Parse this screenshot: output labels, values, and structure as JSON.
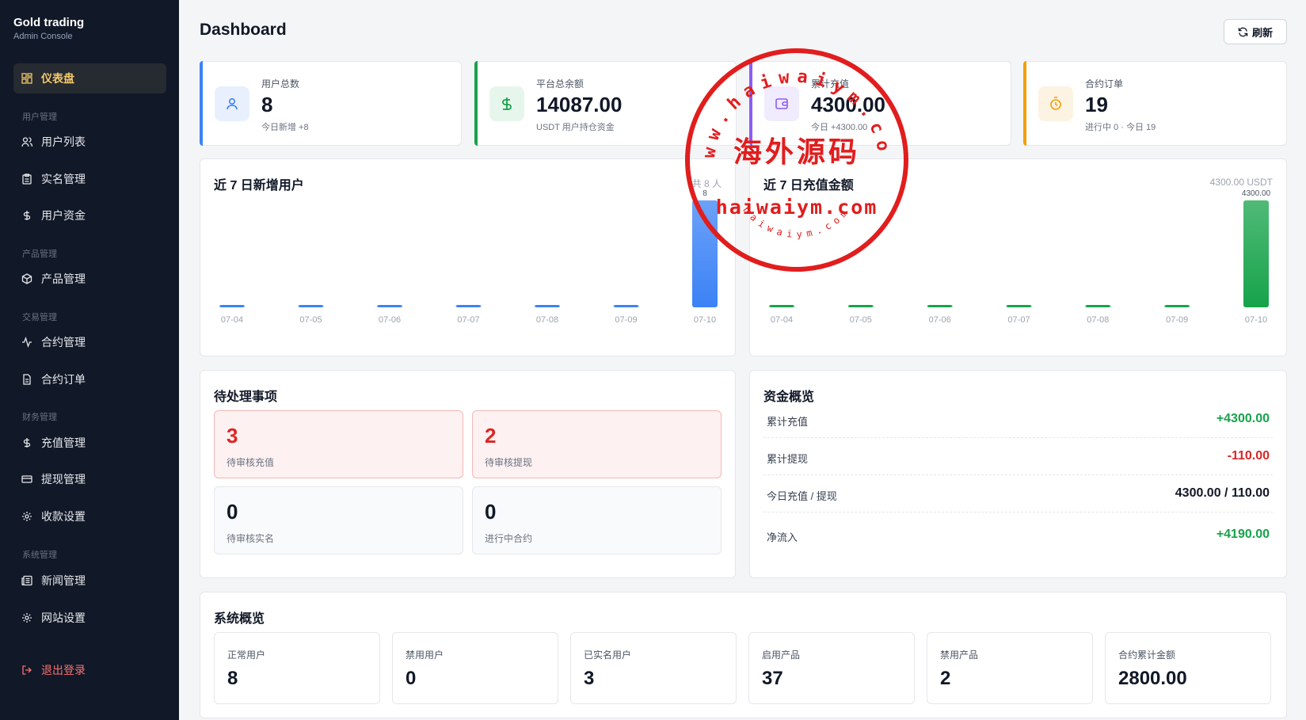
{
  "brand": {
    "title": "Gold trading",
    "subtitle": "Admin Console"
  },
  "nav": {
    "dashboard": "仪表盘",
    "group_users": "用户管理",
    "user_list": "用户列表",
    "kyc": "实名管理",
    "user_funds": "用户资金",
    "group_products": "产品管理",
    "products": "产品管理",
    "group_trading": "交易管理",
    "contracts": "合约管理",
    "contract_orders": "合约订单",
    "group_finance": "财务管理",
    "recharge": "充值管理",
    "withdraw": "提现管理",
    "payment_settings": "收款设置",
    "group_system": "系统管理",
    "news": "新闻管理",
    "site_settings": "网站设置",
    "logout": "退出登录"
  },
  "header": {
    "title": "Dashboard",
    "refresh_label": "刷新"
  },
  "stats": [
    {
      "label": "用户总数",
      "value": "8",
      "sub": "今日新增 +8",
      "accent": "#3b82f6"
    },
    {
      "label": "平台总余额",
      "value": "14087.00",
      "sub": "USDT 用户持仓资金",
      "accent": "#16a34a"
    },
    {
      "label": "累计充值",
      "value": "4300.00",
      "sub": "今日 +4300.00",
      "accent": "#8b5cf6"
    },
    {
      "label": "合约订单",
      "value": "19",
      "sub": "进行中 0 · 今日 19",
      "accent": "#f59e0b"
    }
  ],
  "chart_data": [
    {
      "type": "bar",
      "title": "近 7 日新增用户",
      "meta": "共 8 人",
      "categories": [
        "07-04",
        "07-05",
        "07-06",
        "07-07",
        "07-08",
        "07-09",
        "07-10"
      ],
      "values": [
        0,
        0,
        0,
        0,
        0,
        0,
        8
      ],
      "value_labels": [
        "",
        "",
        "",
        "",
        "",
        "",
        "8"
      ],
      "color": "#3b82f6"
    },
    {
      "type": "bar",
      "title": "近 7 日充值金额",
      "meta": "4300.00 USDT",
      "categories": [
        "07-04",
        "07-05",
        "07-06",
        "07-07",
        "07-08",
        "07-09",
        "07-10"
      ],
      "values": [
        0,
        0,
        0,
        0,
        0,
        0,
        4300
      ],
      "value_labels": [
        "",
        "",
        "",
        "",
        "",
        "",
        "4300.00"
      ],
      "color": "#16a34a"
    }
  ],
  "pending": {
    "title": "待处理事项",
    "items": [
      {
        "value": "3",
        "label": "待审核充值"
      },
      {
        "value": "2",
        "label": "待审核提现"
      },
      {
        "value": "0",
        "label": "待审核实名"
      },
      {
        "value": "0",
        "label": "进行中合约"
      }
    ]
  },
  "funds": {
    "title": "资金概览",
    "rows": [
      {
        "label": "累计充值",
        "value": "+4300.00"
      },
      {
        "label": "累计提现",
        "value": "-110.00"
      },
      {
        "label": "今日充值 / 提现",
        "value": "4300.00 / 110.00"
      },
      {
        "label": "净流入",
        "value": "+4190.00"
      }
    ]
  },
  "system": {
    "title": "系统概览",
    "items": [
      {
        "label": "正常用户",
        "value": "8"
      },
      {
        "label": "禁用用户",
        "value": "0"
      },
      {
        "label": "已实名用户",
        "value": "3"
      },
      {
        "label": "启用产品",
        "value": "37"
      },
      {
        "label": "禁用产品",
        "value": "2"
      },
      {
        "label": "合约累计金额",
        "value": "2800.00"
      }
    ]
  },
  "watermark": {
    "ring_text": "www.haiwaiym.com",
    "center_cn": "海外源码",
    "center_en": "haiwaiym.com",
    "bottom_text": "haiwaiym.com",
    "color": "#e11d1d"
  }
}
